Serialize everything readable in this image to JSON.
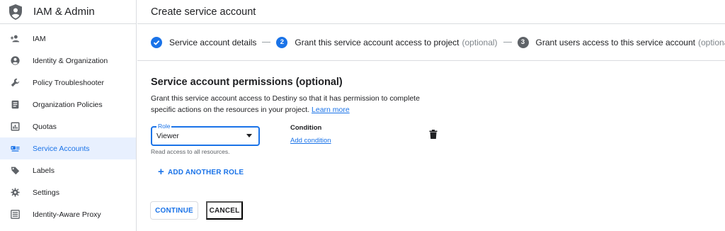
{
  "sidebar": {
    "title": "IAM & Admin",
    "icon": "shield-person-icon",
    "items": [
      {
        "label": "IAM",
        "icon": "person-add-icon",
        "active": false
      },
      {
        "label": "Identity & Organization",
        "icon": "account-circle-icon",
        "active": false
      },
      {
        "label": "Policy Troubleshooter",
        "icon": "wrench-icon",
        "active": false
      },
      {
        "label": "Organization Policies",
        "icon": "document-list-icon",
        "active": false
      },
      {
        "label": "Quotas",
        "icon": "quota-chart-icon",
        "active": false
      },
      {
        "label": "Service Accounts",
        "icon": "service-account-icon",
        "active": true
      },
      {
        "label": "Labels",
        "icon": "label-tag-icon",
        "active": false
      },
      {
        "label": "Settings",
        "icon": "gear-icon",
        "active": false
      },
      {
        "label": "Identity-Aware Proxy",
        "icon": "proxy-icon",
        "active": false
      }
    ]
  },
  "header": {
    "title": "Create service account"
  },
  "stepper": {
    "steps": [
      {
        "badge": "✓",
        "label": "Service account details",
        "optional": "",
        "state": "done"
      },
      {
        "badge": "2",
        "label": "Grant this service account access to project",
        "optional": "(optional)",
        "state": "active"
      },
      {
        "badge": "3",
        "label": "Grant users access to this service account",
        "optional": "(optional)",
        "state": "todo"
      }
    ]
  },
  "permissions": {
    "heading": "Service account permissions (optional)",
    "description": "Grant this service account access to Destiny so that it has permission to complete specific actions on the resources in your project.",
    "learn_more": "Learn more"
  },
  "role": {
    "legend": "Role",
    "value": "Viewer",
    "helper": "Read access to all resources."
  },
  "condition": {
    "label": "Condition",
    "add_link": "Add condition"
  },
  "actions": {
    "add_role": "ADD ANOTHER ROLE",
    "continue": "CONTINUE",
    "cancel": "CANCEL"
  },
  "colors": {
    "accent": "#1a73e8",
    "active_bg": "#e8f0fe",
    "text": "#202124",
    "muted": "#5f6368"
  }
}
